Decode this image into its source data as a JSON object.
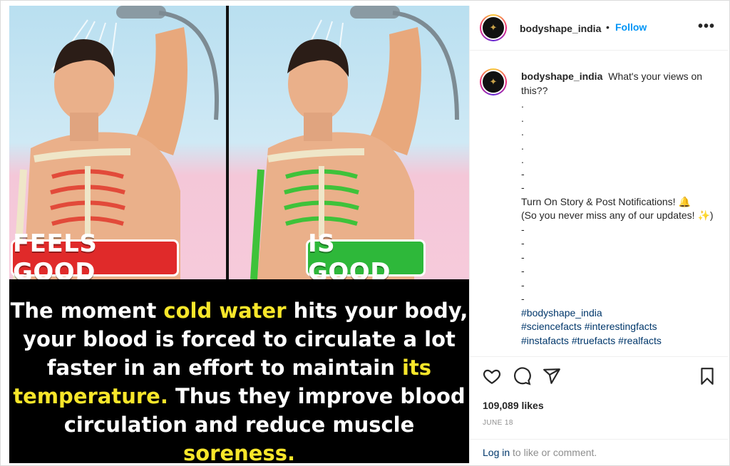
{
  "image": {
    "badge_left": "FEELS GOOD",
    "badge_right": "IS GOOD",
    "caption": {
      "part1": "The moment ",
      "hl1": "cold water",
      "part2": " hits your body, your blood is forced to circulate a lot faster in an effort to maintain ",
      "hl2": "its temperature.",
      "part3": " Thus they improve blood circulation and reduce muscle ",
      "hl3": "soreness."
    }
  },
  "header": {
    "username": "bodyshape_india",
    "separator": "•",
    "follow_label": "Follow",
    "more_label": "•••"
  },
  "post_caption": {
    "username": "bodyshape_india",
    "text": "What's your views on this??",
    "dots": [
      ".",
      ".",
      ".",
      ".",
      ".",
      "-",
      "-"
    ],
    "notify_line1": "Turn On Story & Post Notifications! 🔔",
    "notify_line2": "(So you never miss any of our updates! ✨)",
    "dashes": [
      "-",
      "-",
      "-",
      "-",
      "-",
      "-"
    ],
    "hashtags": [
      "#bodyshape_india",
      "#sciencefacts #interestingfacts",
      "#instafacts #truefacts #realfacts"
    ]
  },
  "actions": {
    "like_icon": "heart-icon",
    "comment_icon": "comment-icon",
    "share_icon": "paper-plane-icon",
    "save_icon": "bookmark-icon"
  },
  "likes_text": "109,089 likes",
  "date_text": "JUNE 18",
  "login": {
    "link": "Log in",
    "text": " to like or comment."
  },
  "colors": {
    "accent": "#0095f6",
    "highlight": "#f7e62a",
    "badge_red": "#e02a2a",
    "badge_green": "#2eb83a"
  }
}
